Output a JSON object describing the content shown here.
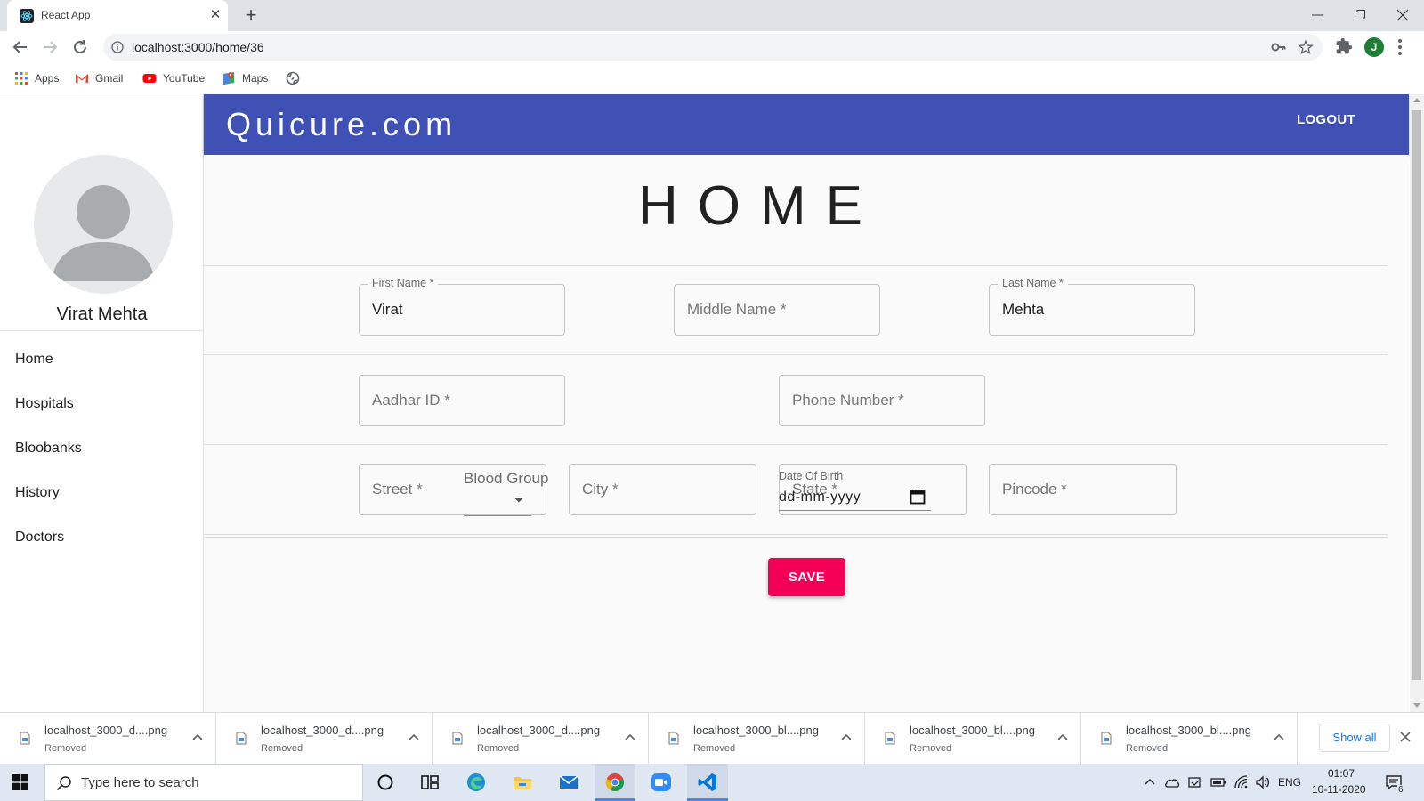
{
  "browser": {
    "tab_title": "React App",
    "url": "localhost:3000/home/36",
    "profile_initial": "J",
    "bookmarks": [
      "Apps",
      "Gmail",
      "YouTube",
      "Maps"
    ]
  },
  "app": {
    "brand": "Quicure.com",
    "logout_label": "LOGOUT",
    "user_name": "Virat Mehta",
    "nav": [
      "Home",
      "Hospitals",
      "Bloobanks",
      "History",
      "Doctors"
    ],
    "page_title": "HOME",
    "form": {
      "first_name_label": "First Name *",
      "first_name_value": "Virat",
      "middle_name_placeholder": "Middle Name *",
      "last_name_label": "Last Name *",
      "last_name_value": "Mehta",
      "aadhar_placeholder": "Aadhar ID *",
      "phone_placeholder": "Phone Number *",
      "street_placeholder": "Street *",
      "city_placeholder": "City *",
      "state_placeholder": "State *",
      "pincode_placeholder": "Pincode *",
      "blood_group_label": "Blood Group",
      "dob_label": "Date Of Birth",
      "dob_placeholder": "dd-mm-yyyy",
      "save_label": "SAVE"
    },
    "colors": {
      "appbar": "#3f51b5",
      "save_button": "#f50057"
    }
  },
  "downloads": {
    "items": [
      {
        "name": "localhost_3000_d....png",
        "status": "Removed"
      },
      {
        "name": "localhost_3000_d....png",
        "status": "Removed"
      },
      {
        "name": "localhost_3000_d....png",
        "status": "Removed"
      },
      {
        "name": "localhost_3000_bl....png",
        "status": "Removed"
      },
      {
        "name": "localhost_3000_bl....png",
        "status": "Removed"
      },
      {
        "name": "localhost_3000_bl....png",
        "status": "Removed"
      }
    ],
    "show_all_label": "Show all"
  },
  "taskbar": {
    "search_placeholder": "Type here to search",
    "language": "ENG",
    "time": "01:07",
    "date": "10-11-2020",
    "notification_count": "6"
  }
}
